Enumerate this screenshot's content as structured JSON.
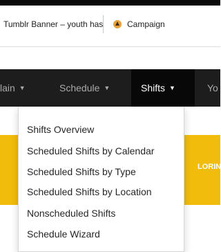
{
  "browser": {
    "tabs": [
      {
        "label": "Tumblr Banner – youth has",
        "icon": "tumblr-favicon-icon"
      },
      {
        "label": "Campaign",
        "icon": "campaign-favicon-icon"
      }
    ]
  },
  "navbar": {
    "items": [
      {
        "label": "lain"
      },
      {
        "label": "Schedule"
      },
      {
        "label": "Shifts",
        "active": true
      },
      {
        "label": "Yo"
      }
    ],
    "caret_icon": "caret-down-icon"
  },
  "dropdown": {
    "items": [
      {
        "label": "Shifts Overview"
      },
      {
        "label": "Scheduled Shifts by Calendar"
      },
      {
        "label": "Scheduled Shifts by Type"
      },
      {
        "label": "Scheduled Shifts by Location"
      },
      {
        "label": "Nonscheduled Shifts"
      },
      {
        "label": "Schedule Wizard"
      }
    ]
  },
  "banner": {
    "text": "LORING",
    "color": "#f2bc0c"
  },
  "colors": {
    "navbar_bg": "#1d1d1d",
    "navbar_active_bg": "#080808",
    "navbar_text": "#a9a9a9",
    "accent": "#f2bc0c"
  }
}
